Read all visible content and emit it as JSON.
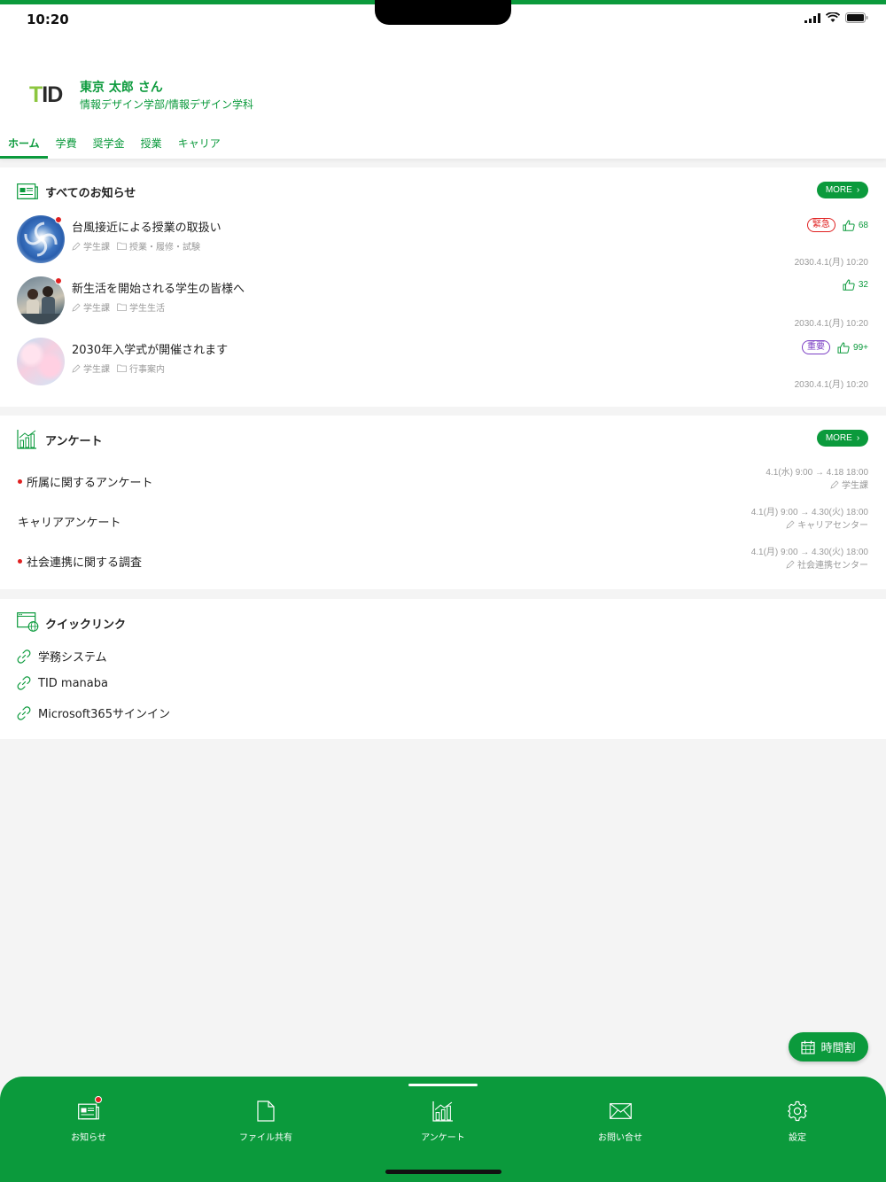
{
  "status_bar": {
    "time": "10:20"
  },
  "header": {
    "logo": {
      "part1": "T",
      "part2": "ID"
    },
    "user_name": "東京 太郎 さん",
    "department": "情報デザイン学部/情報デザイン学科",
    "tabs": [
      {
        "label": "ホーム",
        "active": true
      },
      {
        "label": "学費",
        "active": false
      },
      {
        "label": "奨学金",
        "active": false
      },
      {
        "label": "授業",
        "active": false
      },
      {
        "label": "キャリア",
        "active": false
      }
    ]
  },
  "notices": {
    "title": "すべてのお知らせ",
    "more_label": "MORE",
    "items": [
      {
        "title": "台風接近による授業の取扱い",
        "author": "学生課",
        "category": "授業・履修・試験",
        "badge": "緊急",
        "badge_color": "#e02020",
        "likes": "68",
        "date": "2030.4.1(月) 10:20",
        "unread": true,
        "image": "typhoon"
      },
      {
        "title": "新生活を開始される学生の皆様へ",
        "author": "学生課",
        "category": "学生生活",
        "badge": "",
        "likes": "32",
        "date": "2030.4.1(月) 10:20",
        "unread": true,
        "image": "students"
      },
      {
        "title": "2030年入学式が開催されます",
        "author": "学生課",
        "category": "行事案内",
        "badge": "重要",
        "badge_color": "#7b3fc4",
        "likes": "99+",
        "date": "2030.4.1(月) 10:20",
        "unread": false,
        "image": "sakura"
      }
    ]
  },
  "surveys": {
    "title": "アンケート",
    "more_label": "MORE",
    "items": [
      {
        "title": "所属に関するアンケート",
        "period": "4.1(水) 9:00 → 4.18 18:00",
        "owner": "学生課",
        "unread": true
      },
      {
        "title": "キャリアアンケート",
        "period": "4.1(月) 9:00 → 4.30(火) 18:00",
        "owner": "キャリアセンター",
        "unread": false
      },
      {
        "title": "社会連携に関する調査",
        "period": "4.1(月) 9:00 → 4.30(火) 18:00",
        "owner": "社会連携センター",
        "unread": true
      }
    ]
  },
  "quick_links": {
    "title": "クイックリンク",
    "items": [
      {
        "label": "学務システム"
      },
      {
        "label": "TID manaba"
      },
      {
        "label": "Microsoft365サインイン"
      }
    ]
  },
  "timetable_button": {
    "label": "時間割"
  },
  "bottom_nav": [
    {
      "label": "お知らせ",
      "icon": "news-icon",
      "has_dot": true
    },
    {
      "label": "ファイル共有",
      "icon": "file-icon",
      "has_dot": false
    },
    {
      "label": "アンケート",
      "icon": "chart-icon",
      "has_dot": false,
      "active": true
    },
    {
      "label": "お問い合せ",
      "icon": "mail-icon",
      "has_dot": false
    },
    {
      "label": "設定",
      "icon": "gear-icon",
      "has_dot": false
    }
  ],
  "colors": {
    "brand_green": "#0b9a3c",
    "alert_red": "#e02020",
    "important_purple": "#7b3fc4",
    "logo_lime": "#8cc63f"
  }
}
